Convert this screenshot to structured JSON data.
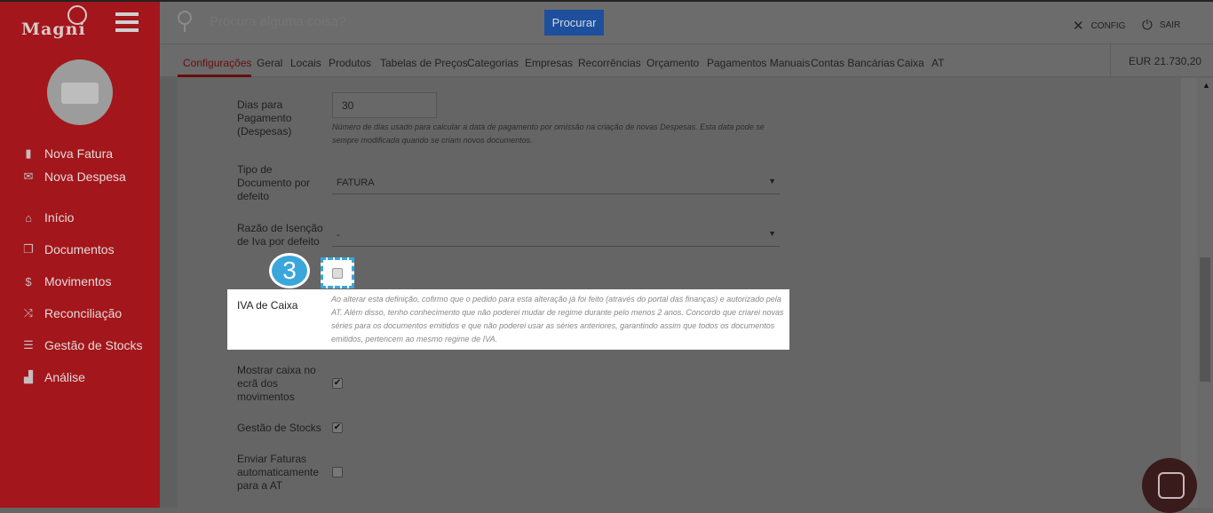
{
  "app": {
    "logo": "Magni"
  },
  "sidebar": {
    "items": [
      {
        "label": "Nova Fatura",
        "icon": "file-icon"
      },
      {
        "label": "Nova Despesa",
        "icon": "envelope-icon"
      },
      {
        "label": "Início",
        "icon": "home-icon"
      },
      {
        "label": "Documentos",
        "icon": "documents-icon"
      },
      {
        "label": "Movimentos",
        "icon": "dollar-icon"
      },
      {
        "label": "Reconciliação",
        "icon": "shuffle-icon"
      },
      {
        "label": "Gestão de Stocks",
        "icon": "stocks-icon"
      },
      {
        "label": "Análise",
        "icon": "chart-icon"
      }
    ]
  },
  "header": {
    "search_placeholder": "Procura alguma coisa?",
    "search_button": "Procurar",
    "config": "CONFIG",
    "logout": "SAIR"
  },
  "tabs": [
    "Configurações",
    "Geral",
    "Locais",
    "Produtos",
    "Tabelas de Preços",
    "Categorias",
    "Empresas",
    "Recorrências",
    "Orçamento",
    "Pagamentos Manuais",
    "Contas Bancárias",
    "Caixa",
    "AT"
  ],
  "balance": "EUR 21.730,20",
  "form": {
    "dias": {
      "label": "Dias para Pagamento (Despesas)",
      "value": "30",
      "help": "Número de dias usado para calcular a data de pagamento por omissão na criação de novas Despesas. Esta data pode se sempre modificada quando se criam novos documentos."
    },
    "tipo": {
      "label": "Tipo de Documento por defeito",
      "value": "FATURA"
    },
    "razao": {
      "label": "Razão de Isenção de Iva por defeito",
      "value": "-"
    },
    "iva": {
      "label": "IVA de Caixa",
      "checked": false,
      "help": "Ao alterar esta definição, cofirmo que o pedido para esta alteração já foi feito (através do portal das finanças) e autorizado pela AT. Além disso, tenho conhecimento que não poderei mudar de regime durante pelo menos 2 anos. Concordo que criarei novas séries para os documentos emitidos e que não poderei usar as séries anteriores, garantindo assim que todos os documentos emitidos, pertencem ao mesmo regime de IVA."
    },
    "mostrar": {
      "label": "Mostrar caixa no ecrã dos movimentos",
      "checked": true
    },
    "stocks": {
      "label": "Gestão de Stocks",
      "checked": true
    },
    "enviar": {
      "label": "Enviar Faturas automaticamente para a AT",
      "checked": false
    }
  },
  "tutorial": {
    "step": "3",
    "accent": "#3aa6dc"
  }
}
